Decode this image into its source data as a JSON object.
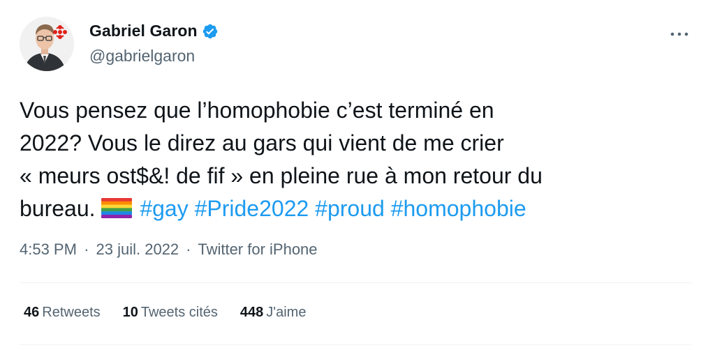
{
  "author": {
    "display_name": "Gabriel Garon",
    "handle": "@gabrielgaron",
    "verified": true,
    "avatar_icon": "avatar-photo-with-cbc-logo"
  },
  "tweet": {
    "line1": "Vous pensez que l’homophobie c’est terminé en",
    "line2": "2022? Vous le direz au gars qui vient de me crier",
    "line3": "« meurs ost$&! de fif » en pleine rue à mon retour du",
    "line4": "bureau.",
    "emoji": "rainbow-flag",
    "hashtags": [
      "#gay",
      "#Pride2022",
      "#proud",
      "#homophobie"
    ]
  },
  "meta": {
    "time": "4:53 PM",
    "date": "23 juil. 2022",
    "separator": "·",
    "source": "Twitter for iPhone"
  },
  "stats": [
    {
      "count": "46",
      "label": "Retweets"
    },
    {
      "count": "10",
      "label": "Tweets cités"
    },
    {
      "count": "448",
      "label": "J'aime"
    }
  ],
  "colors": {
    "link": "#1d9bf0",
    "muted": "#536471",
    "text": "#0f1419",
    "verified": "#1d9bf0",
    "cbc_red": "#e0211b"
  }
}
